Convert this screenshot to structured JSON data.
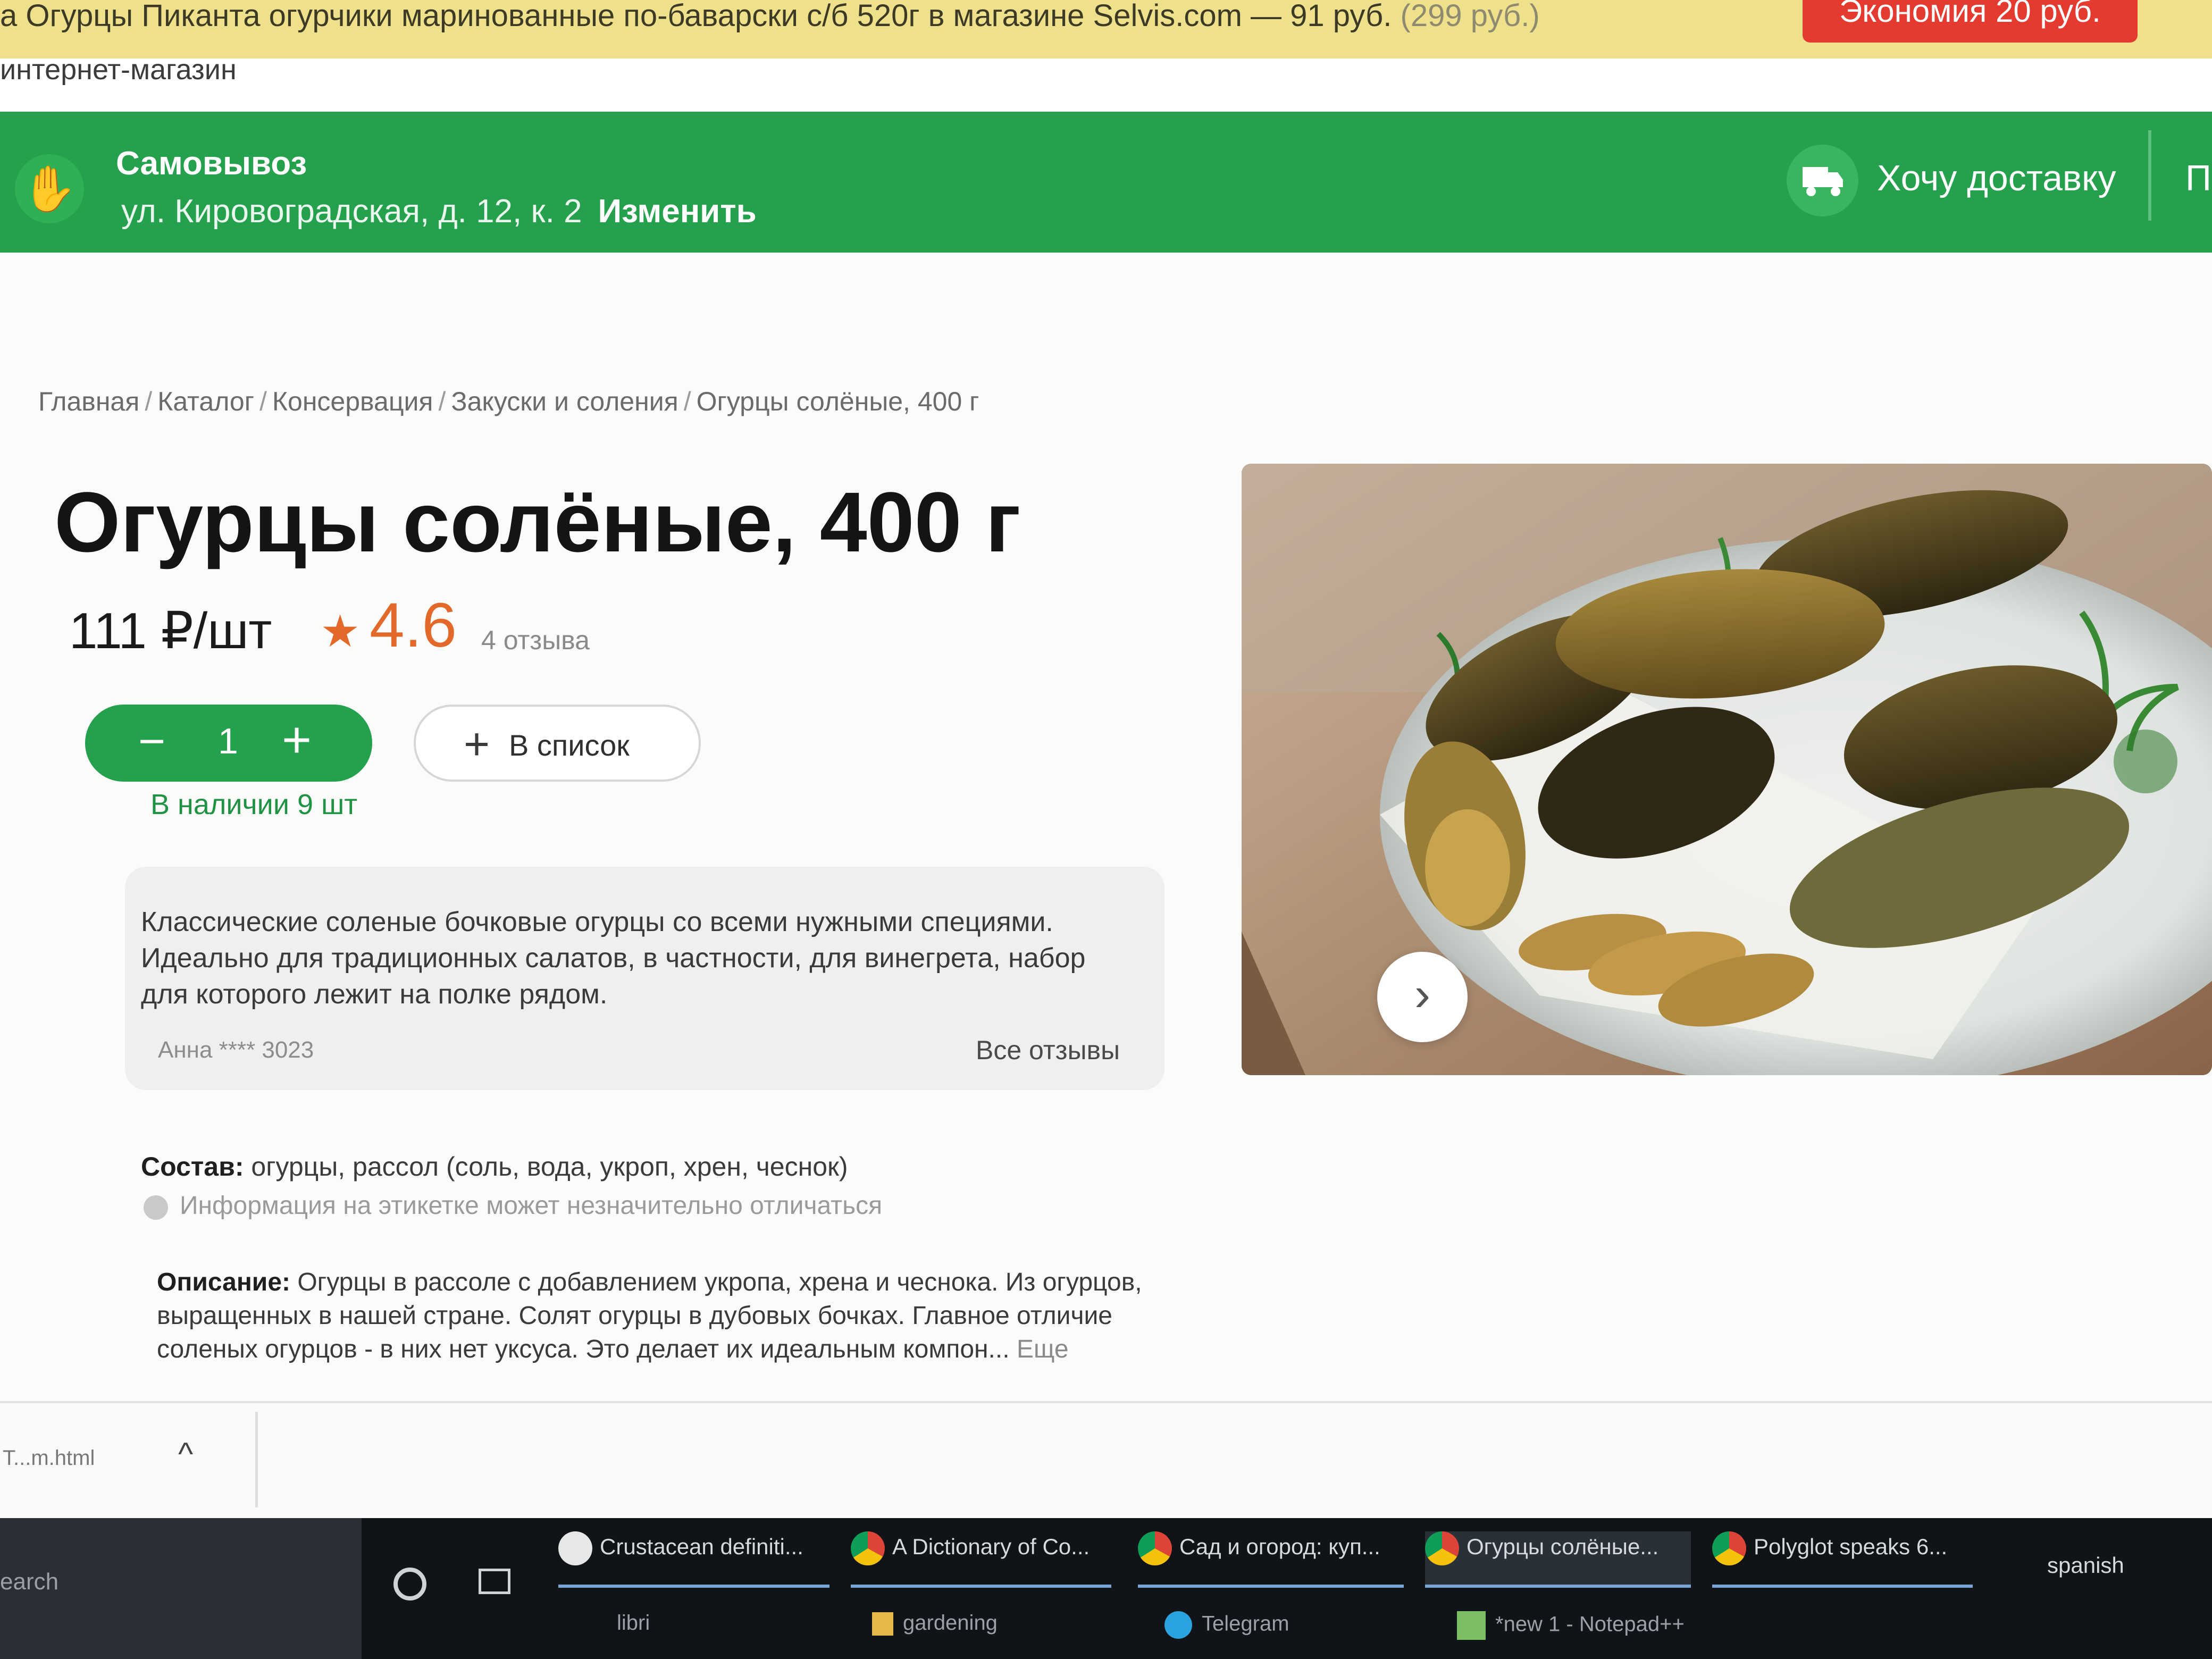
{
  "top_banner": {
    "title": "а Огурцы Пиканта огурчики маринованные по-баварски с/б 520г в магазине Selvis.com — 91 руб.",
    "old_price": "(299 руб.)",
    "economy": "Экономия 20 руб."
  },
  "subheader": {
    "label": "интернет-магазин"
  },
  "delivery_bar": {
    "mode": "Самовывоз",
    "address": "ул. Кировоградская, д. 12, к. 2",
    "change": "Изменить",
    "delivery_option": "Хочу доставку",
    "cut_text": "П"
  },
  "breadcrumb": [
    "Главная",
    "Каталог",
    "Консервация",
    "Закуски и соления",
    "Огурцы солёные, 400 г"
  ],
  "product": {
    "title": "Огурцы солёные, 400 г",
    "price": "111 ₽/шт",
    "rating": "4.6",
    "reviews": "4 отзыва",
    "quantity": "1",
    "stock": "В наличии 9 шт",
    "add_to_list": "В список"
  },
  "review": {
    "text": "Классические соленые бочковые огурцы со всеми нужными специями. Идеально для традиционных салатов, в частности, для винегрета, набор для которого лежит на полке рядом.",
    "author": "Анна **** 3023",
    "all_reviews": "Все отзывы"
  },
  "composition": {
    "label": "Состав:",
    "value": "огурцы, рассол (соль, вода, укроп, хрен, чеснок)",
    "note": "Информация на этикетке может незначительно отличаться"
  },
  "description": {
    "label": "Описание:",
    "text": "Огурцы в рассоле с добавлением укропа, хрена и чеснока. Из огурцов, выращенных в нашей стране. Солят огурцы в дубовых бочках. Главное отличие соленых огурцов - в них нет уксуса. Это делает их идеальным компон...",
    "more": "Еще"
  },
  "downloads": {
    "file": "T...m.html"
  },
  "taskbar": {
    "search": "earch",
    "tasks": [
      {
        "label": "Crustacean definiti...",
        "sub": "libri"
      },
      {
        "label": "A Dictionary of Co...",
        "sub": "gardening"
      },
      {
        "label": "Сад и огород: куп...",
        "sub": "Telegram"
      },
      {
        "label": "Огурцы солёные...",
        "sub": "*new 1 - Notepad++"
      },
      {
        "label": "Polyglot speaks 6...",
        "sub": ""
      },
      {
        "label": "spanish",
        "sub": ""
      }
    ]
  },
  "colors": {
    "brand_green": "#25a04d",
    "rating_orange": "#e3692a",
    "promo_red": "#e53a2f"
  }
}
